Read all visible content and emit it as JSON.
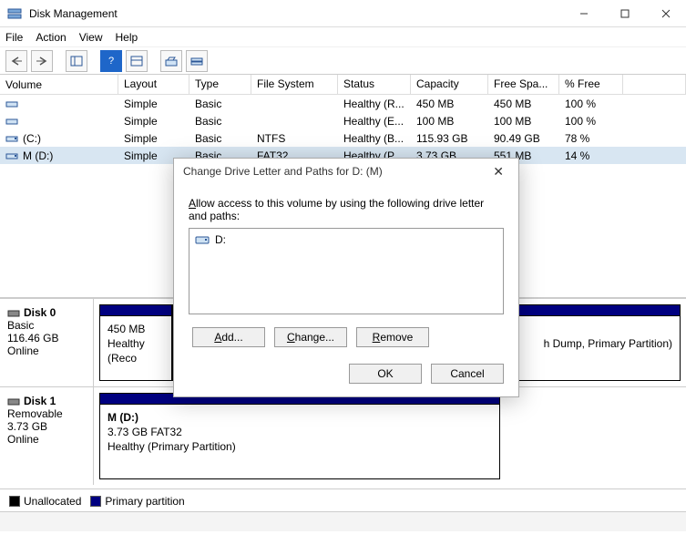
{
  "window": {
    "title": "Disk Management"
  },
  "menu": {
    "file": "File",
    "action": "Action",
    "view": "View",
    "help": "Help"
  },
  "columns": {
    "volume": "Volume",
    "layout": "Layout",
    "type": "Type",
    "fs": "File System",
    "status": "Status",
    "capacity": "Capacity",
    "free": "Free Spa...",
    "pct": "% Free"
  },
  "rows": [
    {
      "name": "",
      "layout": "Simple",
      "type": "Basic",
      "fs": "",
      "status": "Healthy (R...",
      "capacity": "450 MB",
      "free": "450 MB",
      "pct": "100 %"
    },
    {
      "name": "",
      "layout": "Simple",
      "type": "Basic",
      "fs": "",
      "status": "Healthy (E...",
      "capacity": "100 MB",
      "free": "100 MB",
      "pct": "100 %"
    },
    {
      "name": " (C:)",
      "layout": "Simple",
      "type": "Basic",
      "fs": "NTFS",
      "status": "Healthy (B...",
      "capacity": "115.93 GB",
      "free": "90.49 GB",
      "pct": "78 %"
    },
    {
      "name": "M (D:)",
      "layout": "Simple",
      "type": "Basic",
      "fs": "FAT32",
      "status": "Healthy (P...",
      "capacity": "3.73 GB",
      "free": "551 MB",
      "pct": "14 %"
    }
  ],
  "disks": [
    {
      "label": "Disk 0",
      "kind": "Basic",
      "size": "116.46 GB",
      "state": "Online",
      "parts": [
        {
          "title": "",
          "line1": "450 MB",
          "line2": "Healthy (Reco",
          "line3tail": "h Dump, Primary Partition)"
        }
      ]
    },
    {
      "label": "Disk 1",
      "kind": "Removable",
      "size": "3.73 GB",
      "state": "Online",
      "parts": [
        {
          "title": "M  (D:)",
          "line1": "3.73 GB FAT32",
          "line2": "Healthy (Primary Partition)"
        }
      ]
    }
  ],
  "legend": {
    "unalloc": "Unallocated",
    "primary": "Primary partition"
  },
  "dialog": {
    "title": "Change Drive Letter and Paths for D: (M)",
    "instruction": "Allow access to this volume by using the following drive letter and paths:",
    "entry": "D:",
    "add": "Add...",
    "change": "Change...",
    "remove": "Remove",
    "ok": "OK",
    "cancel": "Cancel"
  }
}
